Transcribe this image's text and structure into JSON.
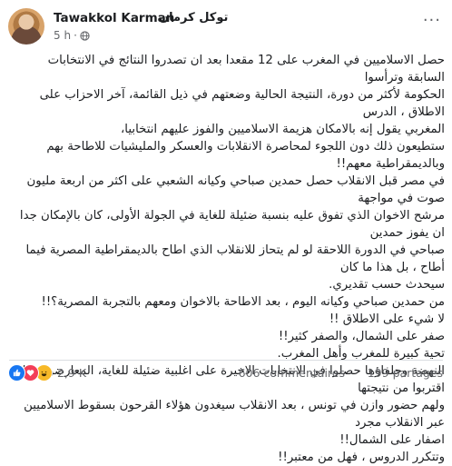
{
  "post": {
    "author": "Tawakkol Karman",
    "author_arabic": "توكل كرمان",
    "time": "5 h",
    "dot": "·",
    "more": "···",
    "paragraphs": [
      "حصل الاسلاميين في المغرب على 12 مقعدا بعد ان تصدروا النتائج في الانتخابات السابقة وترأسوا",
      "الحكومة لأكثر من دورة، النتيجة الحالية وضعتهم في ذيل القائمة، آخر الاحزاب على الاطلاق ، الدرس",
      "المغربي يقول إنه بالامكان هزيمة الاسلاميين والفوز عليهم انتخابيا،",
      "ستطيعون ذلك دون اللجوء لمحاصرة الانقلابات والعسكر والمليشيات للاطاحة بهم وبالديمقراطية معهم!!",
      "في مصر قبل الانقلاب حصل حمدين صباحي وكيانه الشعبي على اكثر من اربعة مليون صوت في مواجهة",
      "مرشح الاخوان الذي تفوق عليه بنسبة ضئيلة للغاية في الجولة الأولى، كان بالإمكان جدا ان يفوز حمدين",
      "صباحي في الدورة اللاحقة لو لم يتحاز للانقلاب الذي اطاح بالديمقراطية المصرية فيما أطاح ، بل هذا ما كان",
      "سيحدث حسب تقديري.",
      "من حمدين صباحي وكيانه اليوم ، بعد الاطاحة بالاخوان ومعهم بالتجربة المصرية؟!!",
      "لا شيء على الاطلاق !!",
      "صفر على الشمال، والصفر كثير!!",
      "تحية كبيرة للمغرب وأهل المغرب.",
      "النهضة وحلفاؤها حصلوا في الانتخابات الاخيرة على اغلبية ضئيلة للغاية، المعارضون لها اقتربوا من نتيجتها",
      "ولهم حضور وازن في تونس ، بعد الانقلاب سيغدون هؤلاء القرحون بسقوط الاسلاميين عبر الانقلاب مجرد",
      "اصفار على الشمال!!",
      "وتتكرر الدروس ، فهل من معتبر!!"
    ]
  },
  "footer": {
    "reaction_count": "2,9 K",
    "comments": "606 commentaires",
    "shares": "199 partages"
  },
  "icons": {
    "like": "thumbs-up",
    "love": "heart",
    "haha": "laughing-face",
    "privacy": "globe"
  },
  "colors": {
    "like": "#1877f2",
    "love": "#f33e58",
    "haha": "#f7b928",
    "meta": "#65676b"
  }
}
